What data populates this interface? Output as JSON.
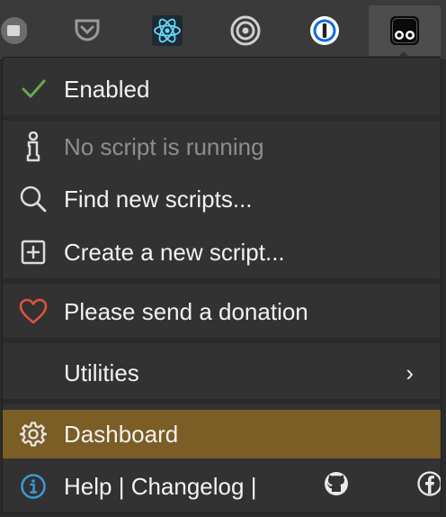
{
  "toolbar": {
    "icons": [
      "extension-icon",
      "pocket-icon",
      "react-devtools-icon",
      "record-icon",
      "onepassword-icon",
      "userscript-manager-icon"
    ]
  },
  "menu": {
    "enabled_label": "Enabled",
    "no_script_label": "No script is running",
    "find_label": "Find new scripts...",
    "create_label": "Create a new script...",
    "donation_label": "Please send a donation",
    "utilities_label": "Utilities",
    "utilities_chevron": "›",
    "dashboard_label": "Dashboard",
    "help_label": "Help",
    "divider": " | ",
    "changelog_label": "Changelog",
    "divider2": " |"
  },
  "colors": {
    "check": "#6aa84f",
    "heart": "#e0533a",
    "info": "#3b9ad9",
    "highlight": "#7b5d26"
  }
}
